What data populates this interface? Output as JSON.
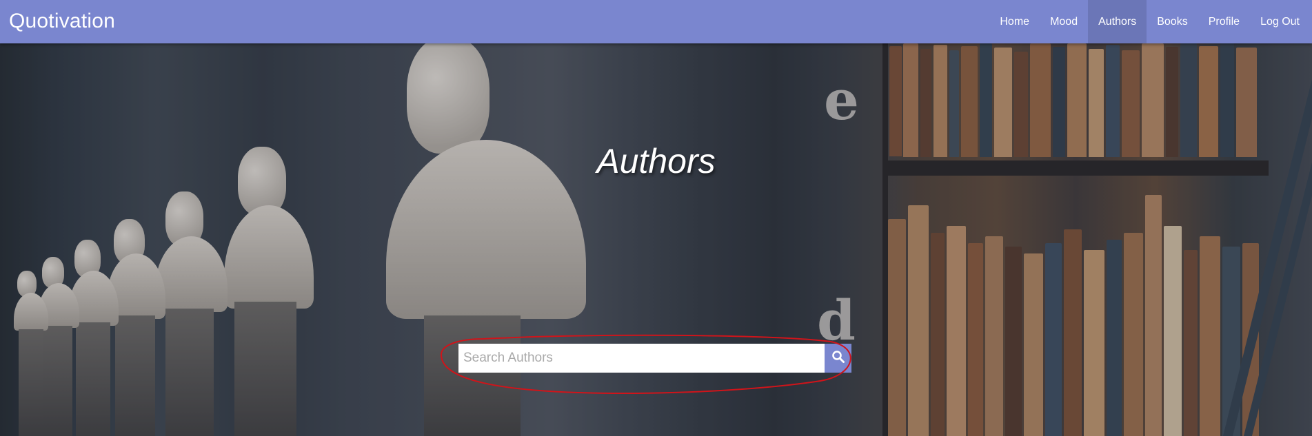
{
  "app": {
    "brand": "Quotivation"
  },
  "nav": {
    "items": [
      {
        "label": "Home"
      },
      {
        "label": "Mood"
      },
      {
        "label": "Authors",
        "active": true
      },
      {
        "label": "Books"
      },
      {
        "label": "Profile"
      },
      {
        "label": "Log Out"
      }
    ]
  },
  "hero": {
    "title": "Authors",
    "shelf_letters": [
      "e",
      "d"
    ],
    "search": {
      "placeholder": "Search Authors",
      "value": "",
      "button_icon": "search-icon"
    }
  },
  "colors": {
    "navbar": "#7a86cf",
    "nav_active": "#6b76b7",
    "search_button": "#7a86cf",
    "annotation": "#d0141a"
  }
}
